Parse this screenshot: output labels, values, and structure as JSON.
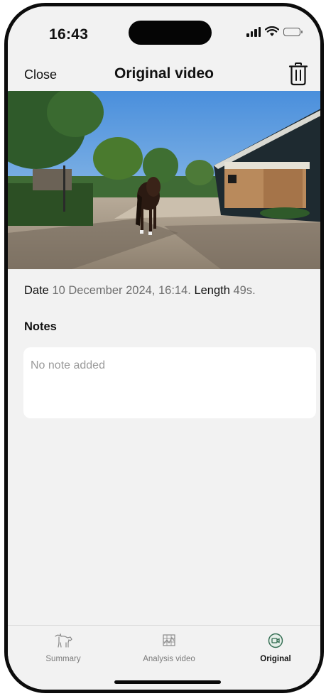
{
  "status_bar": {
    "time": "16:43"
  },
  "nav": {
    "close_label": "Close",
    "title": "Original video"
  },
  "video": {
    "date_label": "Date",
    "date_value": "10 December 2024, 16:14.",
    "length_label": "Length",
    "length_value": "49s."
  },
  "notes": {
    "heading": "Notes",
    "placeholder": "No note added"
  },
  "tabs": [
    {
      "label": "Summary",
      "icon": "horse-icon"
    },
    {
      "label": "Analysis video",
      "icon": "analysis-chart-icon"
    },
    {
      "label": "Original",
      "icon": "video-camera-icon",
      "active": true
    }
  ],
  "colors": {
    "background": "#f2f2f2",
    "accent": "#2f6b4f",
    "muted_text": "#6e6e6e"
  }
}
